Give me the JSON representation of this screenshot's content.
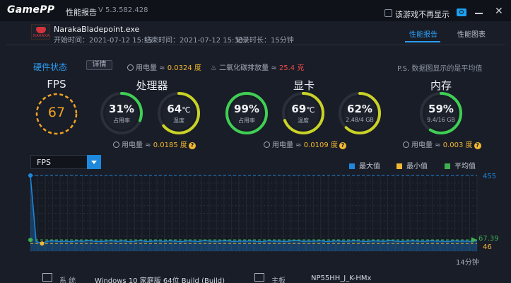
{
  "app": {
    "logo": "GamePP",
    "title": "性能报告",
    "version": "V 5.3.582.428",
    "hide_label": "该游戏不再显示"
  },
  "game": {
    "name": "NarakaBladepoint.exe",
    "icon_text": "NARAKA",
    "start_label": "开始时间：2021-07-12 15:15",
    "end_label": "结束时间：2021-07-12 15:30",
    "duration_label": "记录时长：15分钟"
  },
  "tabs": [
    "性能报告",
    "性能图表"
  ],
  "hardware": {
    "title": "硬件状态",
    "detail_button": "详情",
    "power_prefix": "用电量 ≈ ",
    "total_power": "0.0324 度",
    "carbon_prefix": "二氧化碳排放量 ≈ ",
    "carbon": "25.4 克",
    "note": "P.S. 数据图显示的是平均值"
  },
  "sections": {
    "fps": {
      "title": "FPS",
      "value": "67"
    },
    "cpu": {
      "title": "处理器",
      "power": "0.0185 度",
      "usage": {
        "value": "31%",
        "label": "占用率",
        "fraction": 0.31
      },
      "temp": {
        "value": "64",
        "unit": "℃",
        "label": "温度",
        "fraction": 0.64
      }
    },
    "gpu": {
      "title": "显卡",
      "power": "0.0109 度",
      "usage": {
        "value": "99%",
        "label": "占用率",
        "fraction": 0.99
      },
      "temp": {
        "value": "69",
        "unit": "℃",
        "label": "温度",
        "fraction": 0.69
      },
      "vram": {
        "value": "62%",
        "label": "2.48/4 GB",
        "fraction": 0.62
      }
    },
    "memory": {
      "title": "内存",
      "power": "0.003 度",
      "usage": {
        "value": "59%",
        "label": "9.4/16 GB",
        "fraction": 0.59
      }
    }
  },
  "chart": {
    "select_label": "FPS",
    "legend": [
      {
        "label": "最大值",
        "color": "#1e88dc"
      },
      {
        "label": "最小值",
        "color": "#f2b833"
      },
      {
        "label": "平均值",
        "color": "#3fb04f"
      }
    ],
    "max_label": "455",
    "avg_label": "67.39",
    "min_label": "46",
    "time_label": "14分钟"
  },
  "chart_data": {
    "type": "line",
    "ylim": [
      0,
      455
    ],
    "series": [
      {
        "name": "FPS",
        "values": [
          455,
          58,
          48,
          60,
          62,
          58,
          61,
          57,
          63,
          59,
          64,
          60,
          58,
          61,
          63,
          59,
          62,
          57,
          60,
          64,
          58,
          61,
          62,
          59,
          63,
          60,
          57,
          62,
          61,
          58,
          64,
          60,
          59,
          62,
          63,
          58,
          61,
          60,
          62,
          59,
          57,
          63,
          60,
          61,
          58,
          62,
          64,
          59,
          60,
          61,
          63,
          58,
          60,
          62,
          59,
          61,
          63,
          60,
          58,
          62,
          61,
          59,
          64,
          60,
          58,
          61,
          62,
          60,
          59,
          63,
          61,
          60,
          58,
          62,
          60,
          61,
          59,
          62
        ]
      }
    ],
    "max": 455,
    "min": 46,
    "avg": 67.39
  },
  "footer": {
    "system_label": "系 统",
    "system_value": "Windows 10 家庭版 64位  Build (Build)",
    "board_label": "主板",
    "board_value": "NP55HH_J_K-HMx"
  },
  "colors": {
    "accent": "#2b9cf2",
    "fps_ring": "#f2a222",
    "gauge_green": "#3fcf54",
    "gauge_yellow": "#c9d226",
    "chart_line": "#1e88dc"
  }
}
